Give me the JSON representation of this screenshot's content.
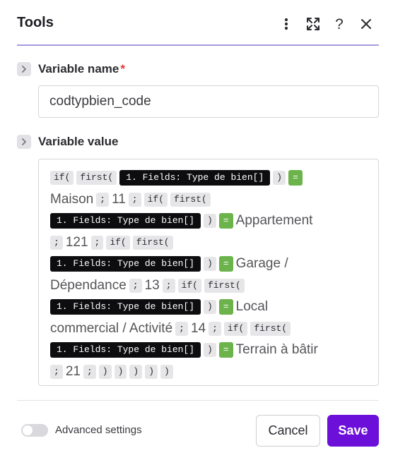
{
  "header": {
    "title": "Tools"
  },
  "variable_name": {
    "label": "Variable name",
    "required_mark": "*",
    "value": "codtypbien_code"
  },
  "variable_value": {
    "label": "Variable value",
    "lines": [
      [
        {
          "k": "tok",
          "t": "if("
        },
        {
          "k": "tok",
          "t": "first("
        },
        {
          "k": "var",
          "t": "1. Fields: Type de bien[]"
        },
        {
          "k": "tok",
          "t": ")"
        },
        {
          "k": "eq",
          "t": "="
        }
      ],
      [
        {
          "k": "txt",
          "t": "Maison"
        },
        {
          "k": "tok",
          "t": ";"
        },
        {
          "k": "txt",
          "t": "11"
        },
        {
          "k": "tok",
          "t": ";"
        },
        {
          "k": "tok",
          "t": "if("
        },
        {
          "k": "tok",
          "t": "first("
        }
      ],
      [
        {
          "k": "var",
          "t": "1. Fields: Type de bien[]"
        },
        {
          "k": "tok",
          "t": ")"
        },
        {
          "k": "eq",
          "t": "="
        },
        {
          "k": "txt",
          "t": "Appartement"
        }
      ],
      [
        {
          "k": "tok",
          "t": ";"
        },
        {
          "k": "txt",
          "t": "121"
        },
        {
          "k": "tok",
          "t": ";"
        },
        {
          "k": "tok",
          "t": "if("
        },
        {
          "k": "tok",
          "t": "first("
        }
      ],
      [
        {
          "k": "var",
          "t": "1. Fields: Type de bien[]"
        },
        {
          "k": "tok",
          "t": ")"
        },
        {
          "k": "eq",
          "t": "="
        },
        {
          "k": "txt",
          "t": "Garage /"
        }
      ],
      [
        {
          "k": "txt",
          "t": "Dépendance"
        },
        {
          "k": "tok",
          "t": ";"
        },
        {
          "k": "txt",
          "t": "13"
        },
        {
          "k": "tok",
          "t": ";"
        },
        {
          "k": "tok",
          "t": "if("
        },
        {
          "k": "tok",
          "t": "first("
        }
      ],
      [
        {
          "k": "var",
          "t": "1. Fields: Type de bien[]"
        },
        {
          "k": "tok",
          "t": ")"
        },
        {
          "k": "eq",
          "t": "="
        },
        {
          "k": "txt",
          "t": "Local"
        }
      ],
      [
        {
          "k": "txt",
          "t": "commercial / Activité"
        },
        {
          "k": "tok",
          "t": ";"
        },
        {
          "k": "txt",
          "t": "14"
        },
        {
          "k": "tok",
          "t": ";"
        },
        {
          "k": "tok",
          "t": "if("
        },
        {
          "k": "tok",
          "t": "first("
        }
      ],
      [
        {
          "k": "var",
          "t": "1. Fields: Type de bien[]"
        },
        {
          "k": "tok",
          "t": ")"
        },
        {
          "k": "eq",
          "t": "="
        },
        {
          "k": "txt",
          "t": "Terrain à bâtir"
        }
      ],
      [
        {
          "k": "tok",
          "t": ";"
        },
        {
          "k": "txt",
          "t": "21"
        },
        {
          "k": "tok",
          "t": ";"
        },
        {
          "k": "tok",
          "t": ")"
        },
        {
          "k": "tok",
          "t": ")"
        },
        {
          "k": "tok",
          "t": ")"
        },
        {
          "k": "tok",
          "t": ")"
        },
        {
          "k": "tok",
          "t": ")"
        }
      ]
    ]
  },
  "footer": {
    "advanced_label": "Advanced settings",
    "advanced_enabled": false,
    "cancel_label": "Cancel",
    "save_label": "Save"
  },
  "colors": {
    "accent": "#6c10d9",
    "header_rule": "#a49ce0",
    "equals_token": "#6bb34a",
    "variable_token": "#0d0d0f",
    "required": "#e0373a"
  },
  "icons": {
    "menu": "vertical-dots-icon",
    "expand": "expand-arrows-icon",
    "help": "question-mark-icon",
    "close": "close-icon",
    "section_toggle": "chevron-right-icon"
  }
}
